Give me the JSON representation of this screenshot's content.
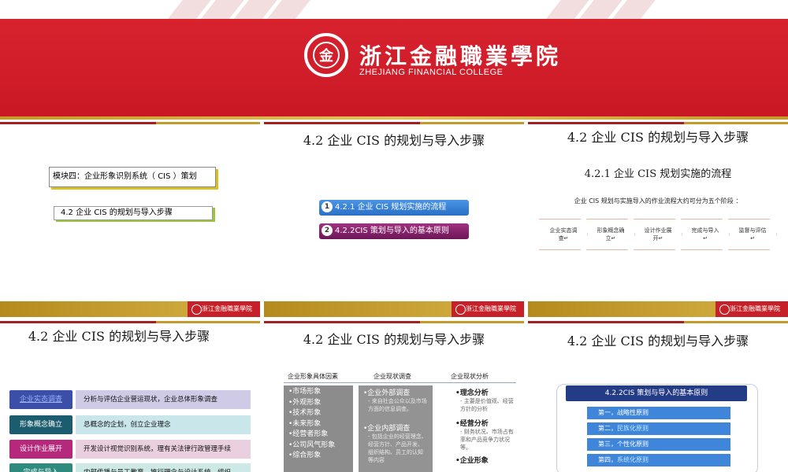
{
  "hero": {
    "college_cn": "浙江金融職業學院",
    "college_en": "ZHEJIANG FINANCIAL COLLEGE"
  },
  "slide_logo": "浙江金融職業學院",
  "slides": {
    "s1": {
      "module": "模块四：企业形象识别系统（ CIS ）策划",
      "section": "4.2    企业 CIS 的规划与导入步骤"
    },
    "s2": {
      "title": "4.2    企业 CIS 的规划与导入步骤",
      "items": [
        {
          "num": "1",
          "label": "4.2.1 企业 CIS 规划实施的流程",
          "color": "#2f7fd6"
        },
        {
          "num": "2",
          "label": "4.2.2CIS 策划与导入的基本原则",
          "color": "#7a1d6a"
        }
      ]
    },
    "s3": {
      "title": "4.2    企业 CIS 的规划与导入步骤",
      "subtitle": "4.2.1 企业 CIS 规划实施的流程",
      "desc": "企业 CIS 规划与实施导入的作业流程大约可分为五个阶段 ：",
      "stages": [
        "企业实态调查↵",
        "形象概念确立↵",
        "设计作业展开↵",
        "完成与导入↵",
        "监督与评估↵"
      ]
    },
    "s4": {
      "title": "4.2    企业 CIS 的规划与导入步骤",
      "rows": [
        {
          "label": "企业实态调查",
          "text": "分析与评估企业营运现状，企业总体形象调查",
          "color": "#3b4ea8",
          "bg": "#cfcbe6"
        },
        {
          "label": "形象概念确立",
          "text": "总概念的企划，创立企业理念",
          "color": "#1b5d6e",
          "bg": "#c9e6ea"
        },
        {
          "label": "设计作业展开",
          "text": "开发设计视觉识别系统，理有关法律行政管理手续",
          "color": "#b5287c",
          "bg": "#ead0df"
        },
        {
          "label": "完成与导入",
          "text": "内部传播与员工教育，推行理念与设计系统，组织",
          "color": "#2f8a7e",
          "bg": "#cde9e5"
        }
      ]
    },
    "s5": {
      "title": "4.2    企业 CIS 的规划与导入步骤",
      "headers": [
        "企业形象具体因素",
        "企业现状调查",
        "企业现状分析"
      ],
      "factors": [
        "•市场形象",
        "•外观形象",
        "•技术形象",
        "•未来形象",
        "•经营者形象",
        "•公司风气形象",
        "•综合形象"
      ],
      "survey_outer": "•企业外部调查",
      "survey_outer_note": "- 来自社会公众以及市场方面的信息调查。",
      "survey_inner": "•企业内部调查",
      "survey_inner_note": "- 包括企业的经营理念、经营方针、产品开发、组织结构、员工的认知等内容",
      "analysis_1": "•理念分析",
      "analysis_1_note": "- 主要是价值观、经营方针的分析",
      "analysis_2": "•经营分析",
      "analysis_2_note": "- 财务状况、市场占有率和产品竞争力状况等。",
      "analysis_3": "•企业形象"
    },
    "s6": {
      "title": "4.2    企业 CIS 的规划与导入步骤",
      "heading": "4.2.2CIS 策划与导入的基本原则",
      "principles": [
        {
          "head": "第一，",
          "tail": "战略性原则"
        },
        {
          "head": "第二，",
          "tail": "民族化原则"
        },
        {
          "head": "第三，",
          "tail": "个性化原则"
        },
        {
          "head": "第四，",
          "tail": "系统化原则"
        }
      ]
    }
  }
}
